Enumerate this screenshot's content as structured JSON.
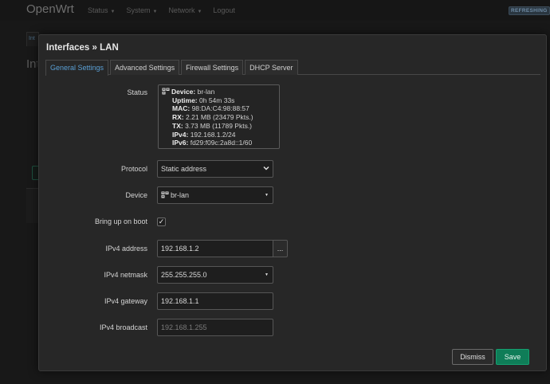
{
  "navbar": {
    "brand": "OpenWrt",
    "menu": [
      {
        "label": "Status",
        "has_dropdown": true
      },
      {
        "label": "System",
        "has_dropdown": true
      },
      {
        "label": "Network",
        "has_dropdown": true
      },
      {
        "label": "Logout",
        "has_dropdown": false
      }
    ],
    "refresh_badge": "REFRESHING"
  },
  "background": {
    "tab_label": "Int",
    "heading": "Int"
  },
  "modal": {
    "title": "Interfaces » LAN",
    "tabs": [
      {
        "label": "General Settings",
        "active": true
      },
      {
        "label": "Advanced Settings",
        "active": false
      },
      {
        "label": "Firewall Settings",
        "active": false
      },
      {
        "label": "DHCP Server",
        "active": false
      }
    ],
    "status": {
      "label": "Status",
      "device_key": "Device:",
      "device_value": "br-lan",
      "uptime_key": "Uptime:",
      "uptime_value": "0h 54m 33s",
      "mac_key": "MAC:",
      "mac_value": "98:DA:C4:98:88:57",
      "rx_key": "RX:",
      "rx_value": "2.21 MB (23479 Pkts.)",
      "tx_key": "TX:",
      "tx_value": "3.73 MB (11789 Pkts.)",
      "ipv4_key": "IPv4:",
      "ipv4_value": "192.168.1.2/24",
      "ipv6_key": "IPv6:",
      "ipv6_value": "fd29:f09c:2a8d::1/60"
    },
    "protocol": {
      "label": "Protocol",
      "value": "Static address"
    },
    "device": {
      "label": "Device",
      "value": "br-lan"
    },
    "bring_up": {
      "label": "Bring up on boot",
      "checked": true,
      "check_glyph": "✓"
    },
    "ipv4_address": {
      "label": "IPv4 address",
      "value": "192.168.1.2",
      "button": "..."
    },
    "ipv4_netmask": {
      "label": "IPv4 netmask",
      "value": "255.255.255.0"
    },
    "ipv4_gateway": {
      "label": "IPv4 gateway",
      "value": "192.168.1.1"
    },
    "ipv4_broadcast": {
      "label": "IPv4 broadcast",
      "placeholder": "192.168.1.255"
    },
    "buttons": {
      "dismiss": "Dismiss",
      "save": "Save"
    }
  },
  "colors": {
    "accent": "#5a9fd4",
    "save": "#0f7d58",
    "modal_bg": "#272727",
    "page_bg": "#181818"
  }
}
